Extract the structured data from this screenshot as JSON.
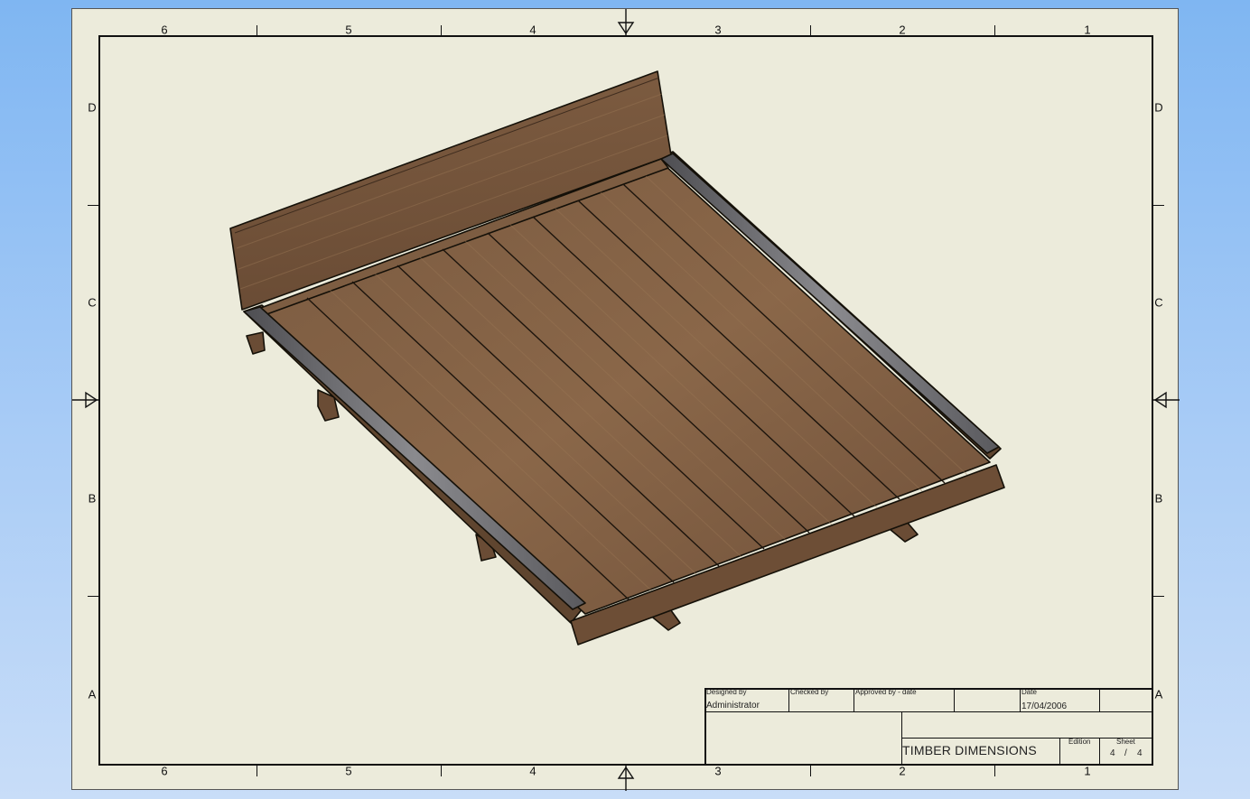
{
  "zones": {
    "columns": [
      "6",
      "5",
      "4",
      "3",
      "2",
      "1"
    ],
    "rows": [
      "D",
      "C",
      "B",
      "A"
    ]
  },
  "title_block": {
    "designed_by_label": "Designed by",
    "designed_by": "Administrator",
    "checked_by_label": "Checked by",
    "approved_by_label": "Approved by - date",
    "date_label": "Date",
    "date": "17/04/2006",
    "title": "TIMBER DIMENSIONS",
    "edition_label": "Edition",
    "sheet_label": "Sheet",
    "sheet_number": "4",
    "sheet_separator": "/",
    "sheet_total": "4"
  },
  "colors": {
    "background": "#8fc0f4",
    "sheet": "#ecebdb",
    "wood_dark": "#5e4430",
    "wood_mid": "#7a5a40",
    "wood_light": "#8f6c4f",
    "steel": "#6d6d70"
  }
}
